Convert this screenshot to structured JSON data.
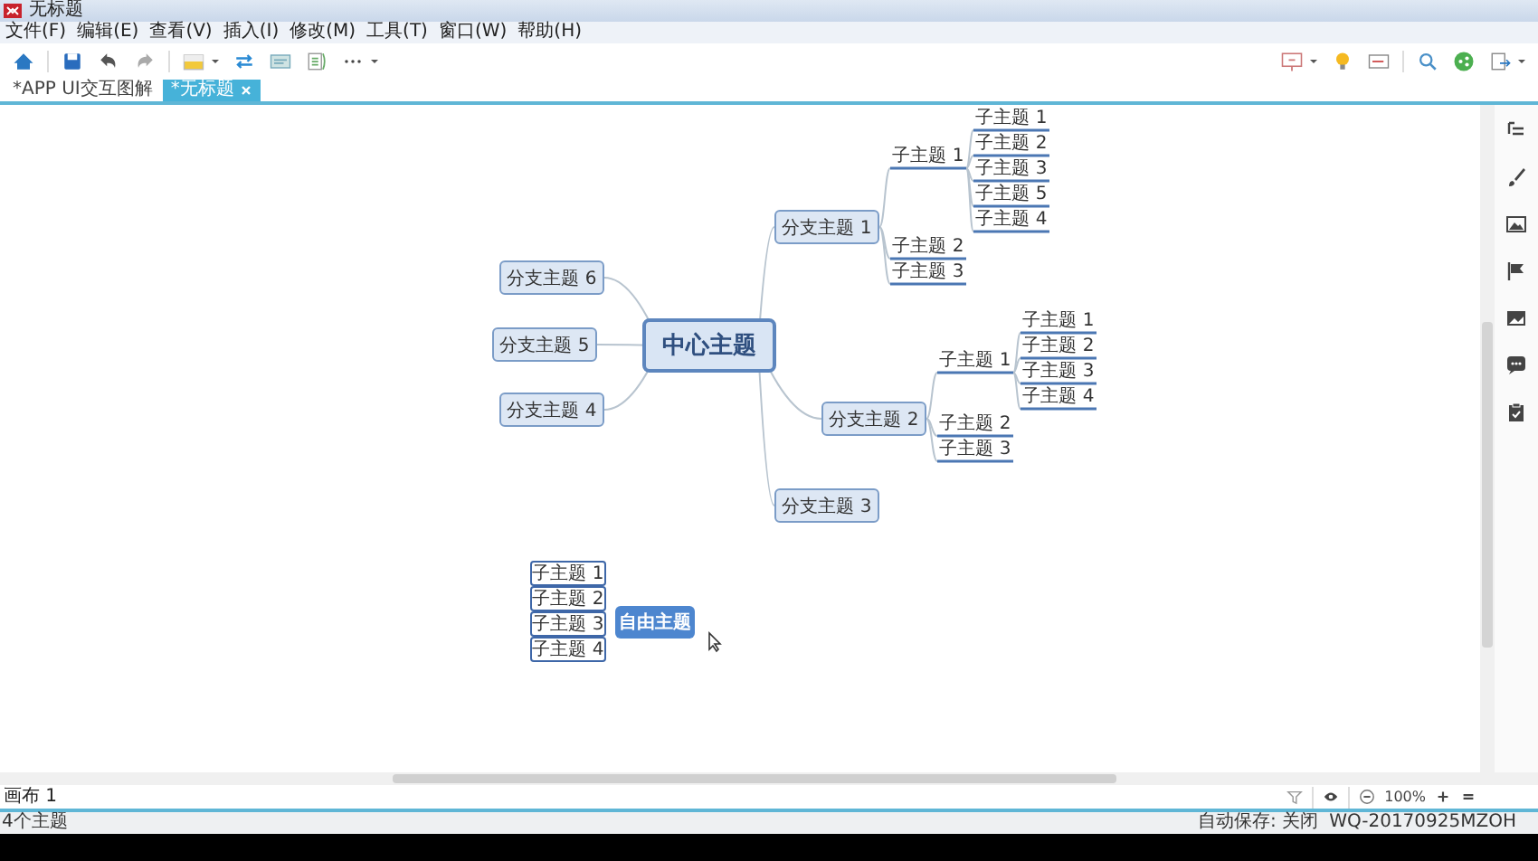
{
  "window": {
    "title": "无标题"
  },
  "menu": [
    "文件(F)",
    "编辑(E)",
    "查看(V)",
    "插入(I)",
    "修改(M)",
    "工具(T)",
    "窗口(W)",
    "帮助(H)"
  ],
  "tabs": [
    {
      "label": "*APP UI交互图解",
      "selected": false
    },
    {
      "label": "*无标题",
      "selected": true
    }
  ],
  "mind_map": {
    "central": "中心主题",
    "branches": [
      {
        "label": "分支主题 1",
        "children": [
          {
            "label": "子主题 1",
            "children": [
              {
                "label": "子主题 1"
              },
              {
                "label": "子主题 2"
              },
              {
                "label": "子主题 3"
              },
              {
                "label": "子主题 5"
              },
              {
                "label": "子主题 4"
              }
            ]
          },
          {
            "label": "子主题 2"
          },
          {
            "label": "子主题 3"
          }
        ]
      },
      {
        "label": "分支主题 6"
      },
      {
        "label": "分支主题 5"
      },
      {
        "label": "分支主题 4"
      },
      {
        "label": "分支主题 2",
        "children": [
          {
            "label": "子主题 1",
            "children": [
              {
                "label": "子主题 1"
              },
              {
                "label": "子主题 2"
              },
              {
                "label": "子主题 3"
              },
              {
                "label": "子主题 4"
              }
            ]
          },
          {
            "label": "子主题 2"
          },
          {
            "label": "子主题 3"
          }
        ]
      },
      {
        "label": "分支主题 3"
      }
    ],
    "floating": {
      "label": "自由主题",
      "children": [
        {
          "label": "子主题 1"
        },
        {
          "label": "子主题 2"
        },
        {
          "label": "子主题 3"
        },
        {
          "label": "子主题 4"
        }
      ]
    }
  },
  "sheet_tabs": [
    {
      "label": "画布 1",
      "selected": true
    }
  ],
  "zoom": "100%",
  "status_bar": {
    "topic_count": "4个主题",
    "autosave": "自动保存: 关闭",
    "user": "WQ-20170925MZOH"
  }
}
